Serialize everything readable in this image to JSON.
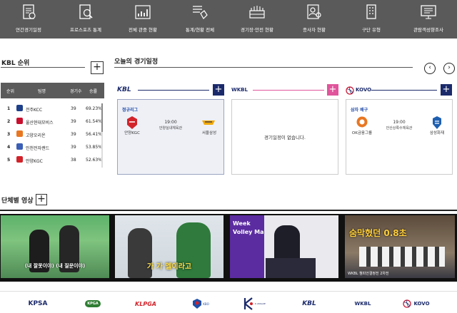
{
  "nav": {
    "items": [
      {
        "label": "연간경기일정",
        "icon": "calendar-doc-icon"
      },
      {
        "label": "프로스포츠 통계",
        "icon": "magnifier-report-icon"
      },
      {
        "label": "전체 관중 현황",
        "icon": "bar-chart-icon"
      },
      {
        "label": "통계/현황 전체",
        "icon": "document-hand-icon"
      },
      {
        "label": "경기장·안전 현황",
        "icon": "stadium-icon"
      },
      {
        "label": "종사자 현황",
        "icon": "person-search-icon"
      },
      {
        "label": "구단 유형",
        "icon": "building-icon"
      },
      {
        "label": "관람객성향조사",
        "icon": "survey-board-icon"
      }
    ]
  },
  "kbl_ranking": {
    "title": "KBL 순위",
    "plus": "+",
    "headers": [
      "순위",
      "팀명",
      "경기수",
      "승률"
    ],
    "rows": [
      {
        "rank": "1",
        "team": "전주KCC",
        "games": "39",
        "pct": "69.23%",
        "color": "#1e3f8a"
      },
      {
        "rank": "2",
        "team": "울산현대모비스",
        "games": "39",
        "pct": "61.54%",
        "color": "#c8102e"
      },
      {
        "rank": "3",
        "team": "고양오리온",
        "games": "39",
        "pct": "56.41%",
        "color": "#e87722"
      },
      {
        "rank": "4",
        "team": "인천전자랜드",
        "games": "39",
        "pct": "53.85%",
        "color": "#3b5fb6"
      },
      {
        "rank": "5",
        "team": "안양KGC",
        "games": "38",
        "pct": "52.63%",
        "color": "#d2232a"
      }
    ]
  },
  "schedule": {
    "title": "오늘의 경기일정",
    "prev": "‹",
    "next": "›",
    "leagues": [
      {
        "logo": "KBL",
        "plus": "+",
        "accent": "#1b2a6b"
      },
      {
        "logo": "WKBL",
        "plus": "+",
        "accent": "#e0559c"
      },
      {
        "logo": "KOVO",
        "plus": "+",
        "accent": "#1b2a6b"
      }
    ],
    "cards": [
      {
        "category": "정규리그",
        "time": "19:00",
        "venue": "안양실내체육관",
        "home": "안양KGC",
        "away": "서울삼성"
      },
      {
        "empty": "경기일정이 없습니다."
      },
      {
        "category": "삼자 배구",
        "time": "19:00",
        "venue": "안산상록수체육관",
        "home": "OK금융그룹",
        "away": "삼성화재"
      }
    ]
  },
  "videos": {
    "title": "단체별 영상",
    "plus": "+",
    "items": [
      {
        "caption": "(내 잘못이야) (내 질문이야)"
      },
      {
        "caption": "가 가 멜이라고"
      },
      {
        "caption": "Week Volley Ma"
      },
      {
        "caption": "숨막혔던 0.8초",
        "sub": "WKBL 챔피언결정전 2차전"
      }
    ]
  },
  "footer": {
    "logos": [
      "KPSA",
      "KPGA",
      "KLPGA",
      "KBO",
      "K LEAGUE",
      "KBL",
      "WKBL",
      "KOVO"
    ]
  }
}
